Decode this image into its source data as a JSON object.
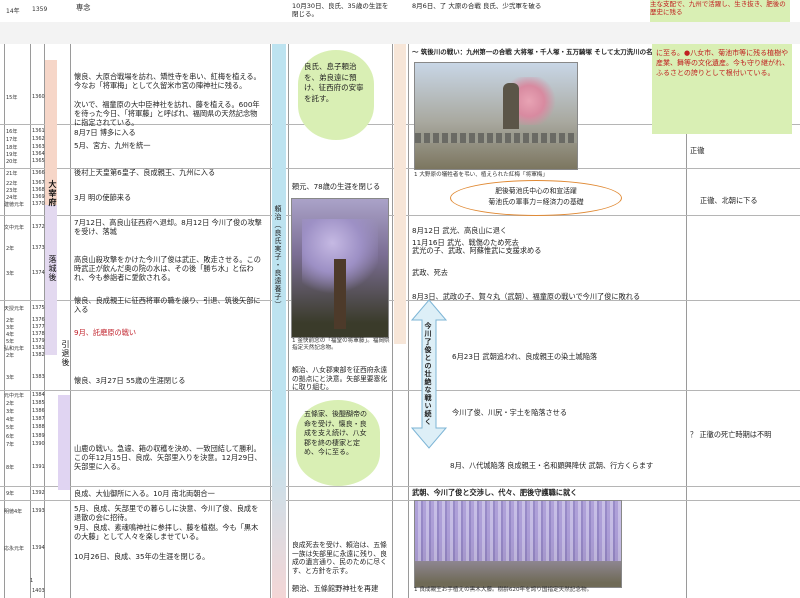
{
  "top_strip": {
    "year_label": "14年",
    "year_num": "1359",
    "text_left": "専念",
    "text_mid": "10月30日、良氏、35歳の生涯を閉じる。",
    "text_right": "8月6日、了 大原の合戦 良氏、少弐軍を破る",
    "note": "主な支配で、九州で活躍し、生き抜き、肥後の歴史に残る"
  },
  "years": [
    {
      "label": "15年",
      "num": "1360"
    },
    {
      "label": "16年",
      "num": "1361"
    },
    {
      "label": "17年",
      "num": "1362"
    },
    {
      "label": "18年",
      "num": "1363"
    },
    {
      "label": "19年",
      "num": "1364"
    },
    {
      "label": "20年",
      "num": "1365"
    },
    {
      "label": "21年",
      "num": "1366"
    },
    {
      "label": "22年",
      "num": "1367"
    },
    {
      "label": "23年",
      "num": "1368"
    },
    {
      "label": "24年",
      "num": "1369"
    },
    {
      "label": "建徳元年",
      "num": "1370"
    },
    {
      "label": "文中元年",
      "num": "1372"
    },
    {
      "label": "2年",
      "num": "1373"
    },
    {
      "label": "3年",
      "num": "1374"
    },
    {
      "label": "天授元年",
      "num": "1375"
    },
    {
      "label": "2年",
      "num": "1376"
    },
    {
      "label": "3年",
      "num": "1377"
    },
    {
      "label": "4年",
      "num": "1378"
    },
    {
      "label": "5年",
      "num": "1379"
    },
    {
      "label": "弘和元年",
      "num": "1381"
    },
    {
      "label": "2年",
      "num": "1382"
    },
    {
      "label": "3年",
      "num": "1383"
    },
    {
      "label": "元中元年",
      "num": "1384"
    },
    {
      "label": "2年",
      "num": "1385"
    },
    {
      "label": "3年",
      "num": "1386"
    },
    {
      "label": "4年",
      "num": "1387"
    },
    {
      "label": "5年",
      "num": "1388"
    },
    {
      "label": "6年",
      "num": "1389"
    },
    {
      "label": "7年",
      "num": "1390"
    },
    {
      "label": "8年",
      "num": "1391"
    },
    {
      "label": "9年",
      "num": "1392"
    },
    {
      "label": "明徳4年",
      "num": "1393"
    },
    {
      "label": "応永元年",
      "num": "1394"
    },
    {
      "label": "1",
      "num": "1403"
    }
  ],
  "era_labels": {
    "dazaifu": "大宰府",
    "rakujo": "落城後",
    "intai": "引退後"
  },
  "events": {
    "e1": "懐良、大原合戦場を訪れ、矯性寺を串い、紅梅を植える。今なお「将軍梅」として久留米市宮の陣神社に残る。",
    "e1b": "次いで、福童原の大中臣神社を訪れ、藤を植える。600年を待った今日、「将軍藤」と呼ばれ、福岡県の天然記念物に指定されている。",
    "e2": "8月7日 博多に入る",
    "e3": "5月、宮方、九州を統一",
    "e4": "後村上天皇第6皇子、良成親王、九州に入る",
    "e5": "3月 明の使節来る",
    "e6": "7月12日、高良山征西府へ退却。8月12日 今川了俊の攻撃を受け、落城",
    "e7": "高良山殺攻撃をかけた今川了俊は武正、敗走させる。この時武正が飲んだ奥の院の水は、その後「勝ち水」と伝われ、今も参詣者に愛飲される。",
    "e8": "懐良、良成親王に征西将軍の職を譲り、引退、筑後矢部に入る",
    "e9": "9月、託磨原の戦い",
    "e10": "懐良、3月27日 55歳の生涯閉じる",
    "e11": "山鹿の戦い。急遽、箱の収穫を決め、一致団結して勝利。この年12月15日、良成、矢部里入りを決意。12月29日、矢部里に入る。",
    "e12": "良成、大仙御所に入る。10月 南北両朝合一",
    "e13": "5月、良成、矢部里での暮らしに決意、今川了俊、良成を退散の会に招待。",
    "e14": "9月、良成、素魂鳴神社に参拝し、藤を植樹。今も「黒木の大藤」として人々を楽しませている。",
    "e15": "10月26日、良成、35年の生涯を閉じる。"
  },
  "middle": {
    "vertical_label": "頼治（良氏実子・良遠養子）",
    "note1": "良氏、息子頼治を、弟良遠に預け、征西府の安寧を託す。",
    "t1": "頼元、78歳の生涯を閉じる",
    "caption1": "1 金快前念の「福堂の将軍藤」。福岡県指定天然記念物。",
    "t2": "頼治、八女郡東部を征西府永遠の拠点にと決意。矢部里要塞化に取り組む。",
    "note2": "五條家、後醍醐帝の命を受け、懐良・良成を支え続け、八女郡を終の棲家と定め、今に至る。",
    "t3": "良成死去を受け、頼治は、五條一族は矢部里に永遠に残り、良成の遺言通り、民のために尽くす、と方針を示す。",
    "t4": "頼治、五條館野神社を再建"
  },
  "right": {
    "heading": "～ 筑後川の戦い：九州第一の合戦 大将塚・千人塚・五万騎塚 そして太刀洗川の名",
    "caption_top": "1 大野原の犠牲者を弔い、植えられた紅梅「将軍梅」",
    "oval_line1": "肥後菊池氏中心の和宣活躍",
    "oval_line2": "菊池氏の軍事力＝経済力の基礎",
    "r1": "8月12日 武光、高良山に退く",
    "r2": "11月16日 武光、戦傷のため死去",
    "r2b": "武光の子、武政、阿蘇惟武に支援求める",
    "r3": "武政、死去",
    "r4": "8月3日、武政の子、賀々丸（武朝）、福童原の戦いで今川了俊に敗れる",
    "vertical_arrow": "今川了俊との壮絶な戦い続く",
    "r5": "6月23日 武朝追われ、良成親王の染土城陥落",
    "r6": "今川了俊、川尻・宇土を陥落させる",
    "r7": "8月、八代城陥落 良成親王・名和顕興降伏 武朝、行方くらます",
    "r8": "武朝、今川了俊と交渉し、代々、肥後守護職に就く",
    "caption_bottom": "1 良成親王お手植えの黒木大藤。樹齢620年を誇り国指定天然記念物。"
  },
  "far_right": {
    "note": "に至る。●八女市、菊池市等に残る植樹や産業、舞等の文化遺産。今も守り継がれ、ふるさとの誇りとして根付いている。",
    "c1": "正徹",
    "c2": "正徹、北朝に下る",
    "c3": "？ 正徹の死亡時期は不明"
  }
}
